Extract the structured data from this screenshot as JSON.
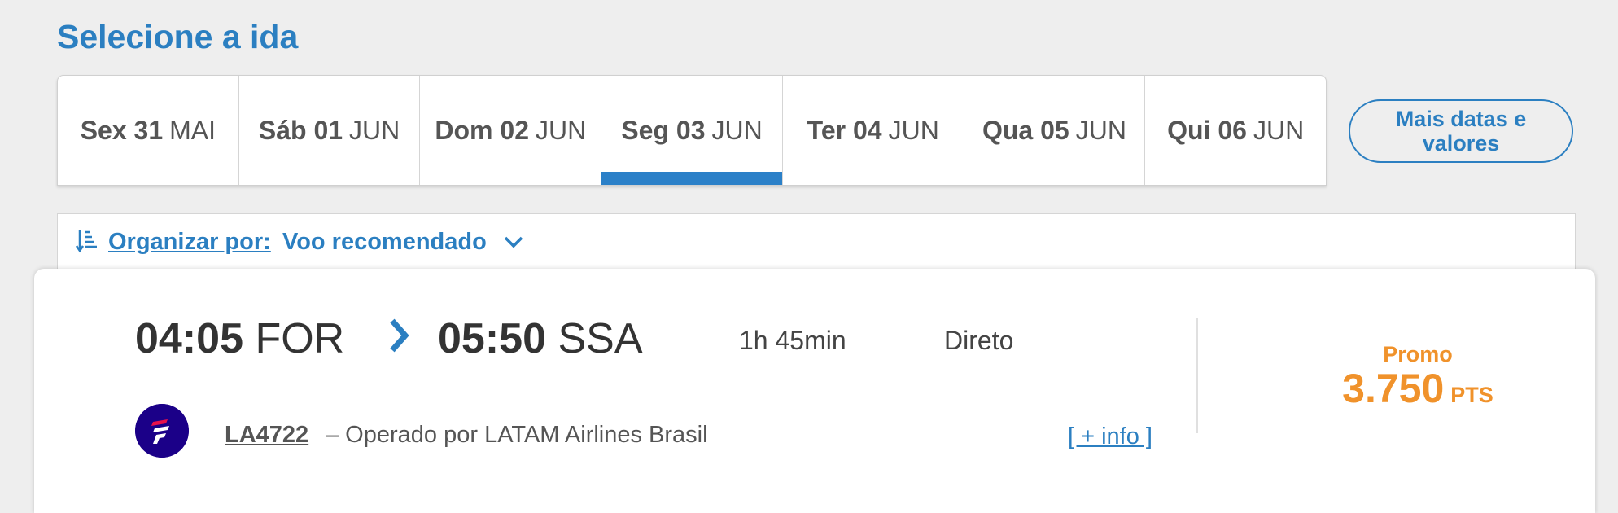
{
  "page": {
    "title": "Selecione a ida"
  },
  "dates": [
    {
      "weekday": "Sex 31",
      "month": "MAI",
      "active": false
    },
    {
      "weekday": "Sáb 01",
      "month": "JUN",
      "active": false
    },
    {
      "weekday": "Dom 02",
      "month": "JUN",
      "active": false
    },
    {
      "weekday": "Seg 03",
      "month": "JUN",
      "active": true
    },
    {
      "weekday": "Ter 04",
      "month": "JUN",
      "active": false
    },
    {
      "weekday": "Qua 05",
      "month": "JUN",
      "active": false
    },
    {
      "weekday": "Qui 06",
      "month": "JUN",
      "active": false
    }
  ],
  "more_dates_label": "Mais datas e valores",
  "sort": {
    "label": "Organizar por:",
    "value": "Voo recomendado"
  },
  "flight": {
    "departure_time": "04:05",
    "departure_airport": "FOR",
    "arrival_time": "05:50",
    "arrival_airport": "SSA",
    "duration": "1h 45min",
    "stops": "Direto",
    "flight_number": "LA4722",
    "operator": "– Operado por LATAM Airlines Brasil",
    "more_info": "[ + info ]",
    "fare_type": "Promo",
    "price": "3.750",
    "price_unit": "PTS"
  },
  "colors": {
    "accent_blue": "#2b7fc1",
    "price_orange": "#f0922b",
    "latam_indigo": "#1b0088"
  }
}
